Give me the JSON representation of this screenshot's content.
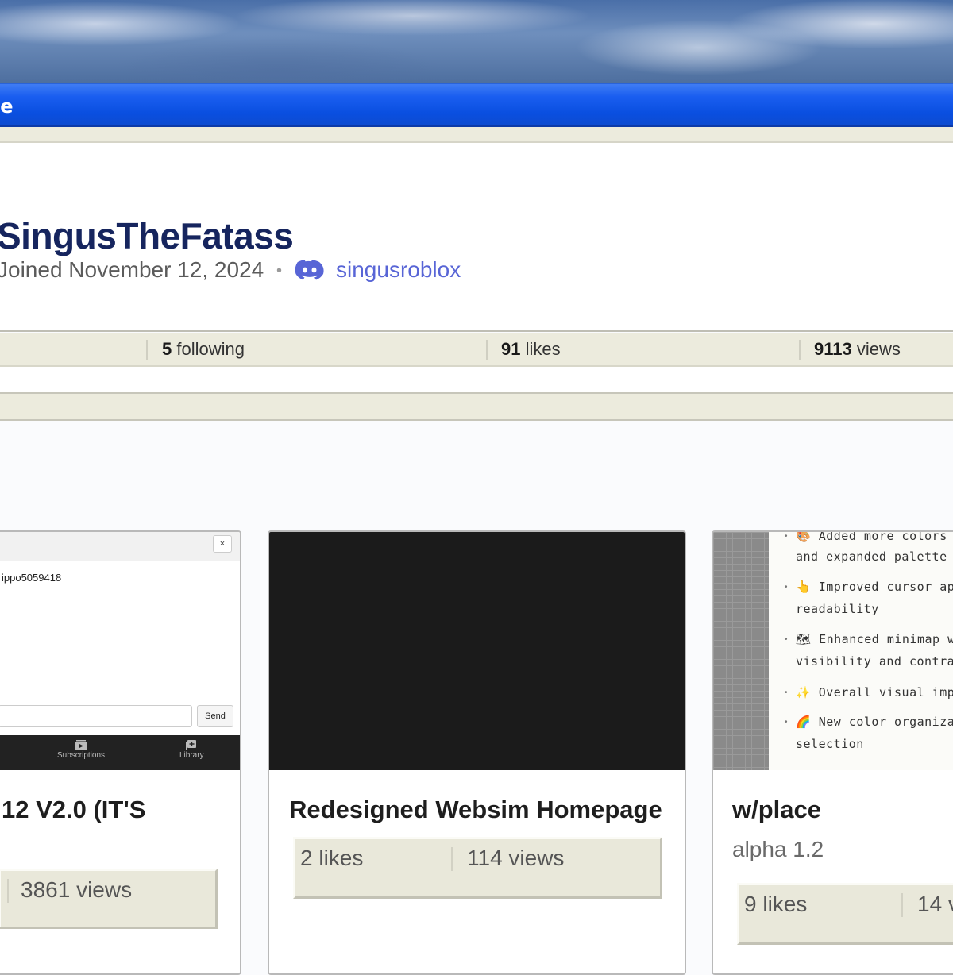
{
  "window": {
    "title": "le"
  },
  "profile": {
    "username": "SingusTheFatass",
    "joined": "Joined November 12, 2024",
    "separator": "•",
    "discord": "singusroblox"
  },
  "stats": {
    "following_count": "5",
    "following_label": " following",
    "likes_count": "91",
    "likes_label": " likes",
    "views_count": "9113",
    "views_label": " views"
  },
  "cards": [
    {
      "title": "12 V2.0 (IT'S",
      "views": "3861 views",
      "thumb": {
        "close": "×",
        "username": "ippo5059418",
        "send": "Send",
        "nav": [
          "Subscriptions",
          "Library"
        ]
      }
    },
    {
      "title": "Redesigned Websim Homepage",
      "likes": "2 likes",
      "views": "114 views"
    },
    {
      "title": "w/place",
      "subtitle": "alpha 1.2",
      "likes": "9 likes",
      "views": "14 v",
      "thumb": {
        "lines": [
          "🎨 Added more colors in",
          "and expanded palette",
          "👆 Improved cursor app",
          "readability",
          "🗺 Enhanced minimap wit",
          "visibility and contrast",
          "✨ Overall visual impro",
          "🌈 New color organizatio",
          "selection"
        ]
      }
    }
  ],
  "colors": {
    "titlebar": "#0a4fe0",
    "username": "#16255e",
    "discord": "#5865d6",
    "panel_beige": "#ecebdd"
  }
}
